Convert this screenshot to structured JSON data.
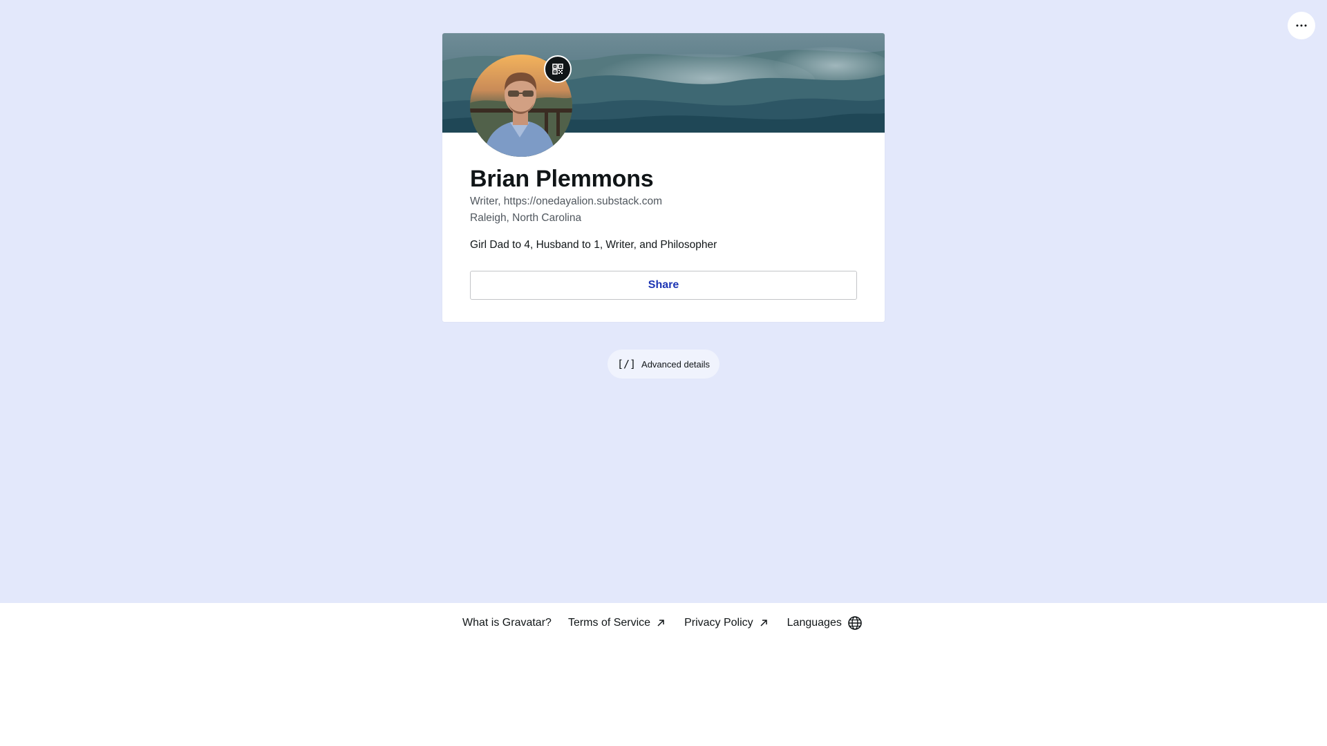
{
  "menu": {
    "more_icon": "ellipsis-icon"
  },
  "profile": {
    "name": "Brian Plemmons",
    "job": "Writer, https://onedayalion.substack.com",
    "location": "Raleigh, North Carolina",
    "bio": "Girl Dad to 4, Husband to 1, Writer, and Philosopher",
    "qr_icon": "qr-code-icon",
    "header_image": "mountain-landscape"
  },
  "actions": {
    "share_label": "Share",
    "advanced_label": "Advanced details",
    "advanced_icon_text": "[/]"
  },
  "footer": {
    "what_is": "What is Gravatar?",
    "terms": "Terms of Service",
    "privacy": "Privacy Policy",
    "languages": "Languages"
  },
  "colors": {
    "page_background": "#e3e8fb",
    "accent": "#1d35b4",
    "text": "#101517",
    "muted_text": "#50575e"
  }
}
